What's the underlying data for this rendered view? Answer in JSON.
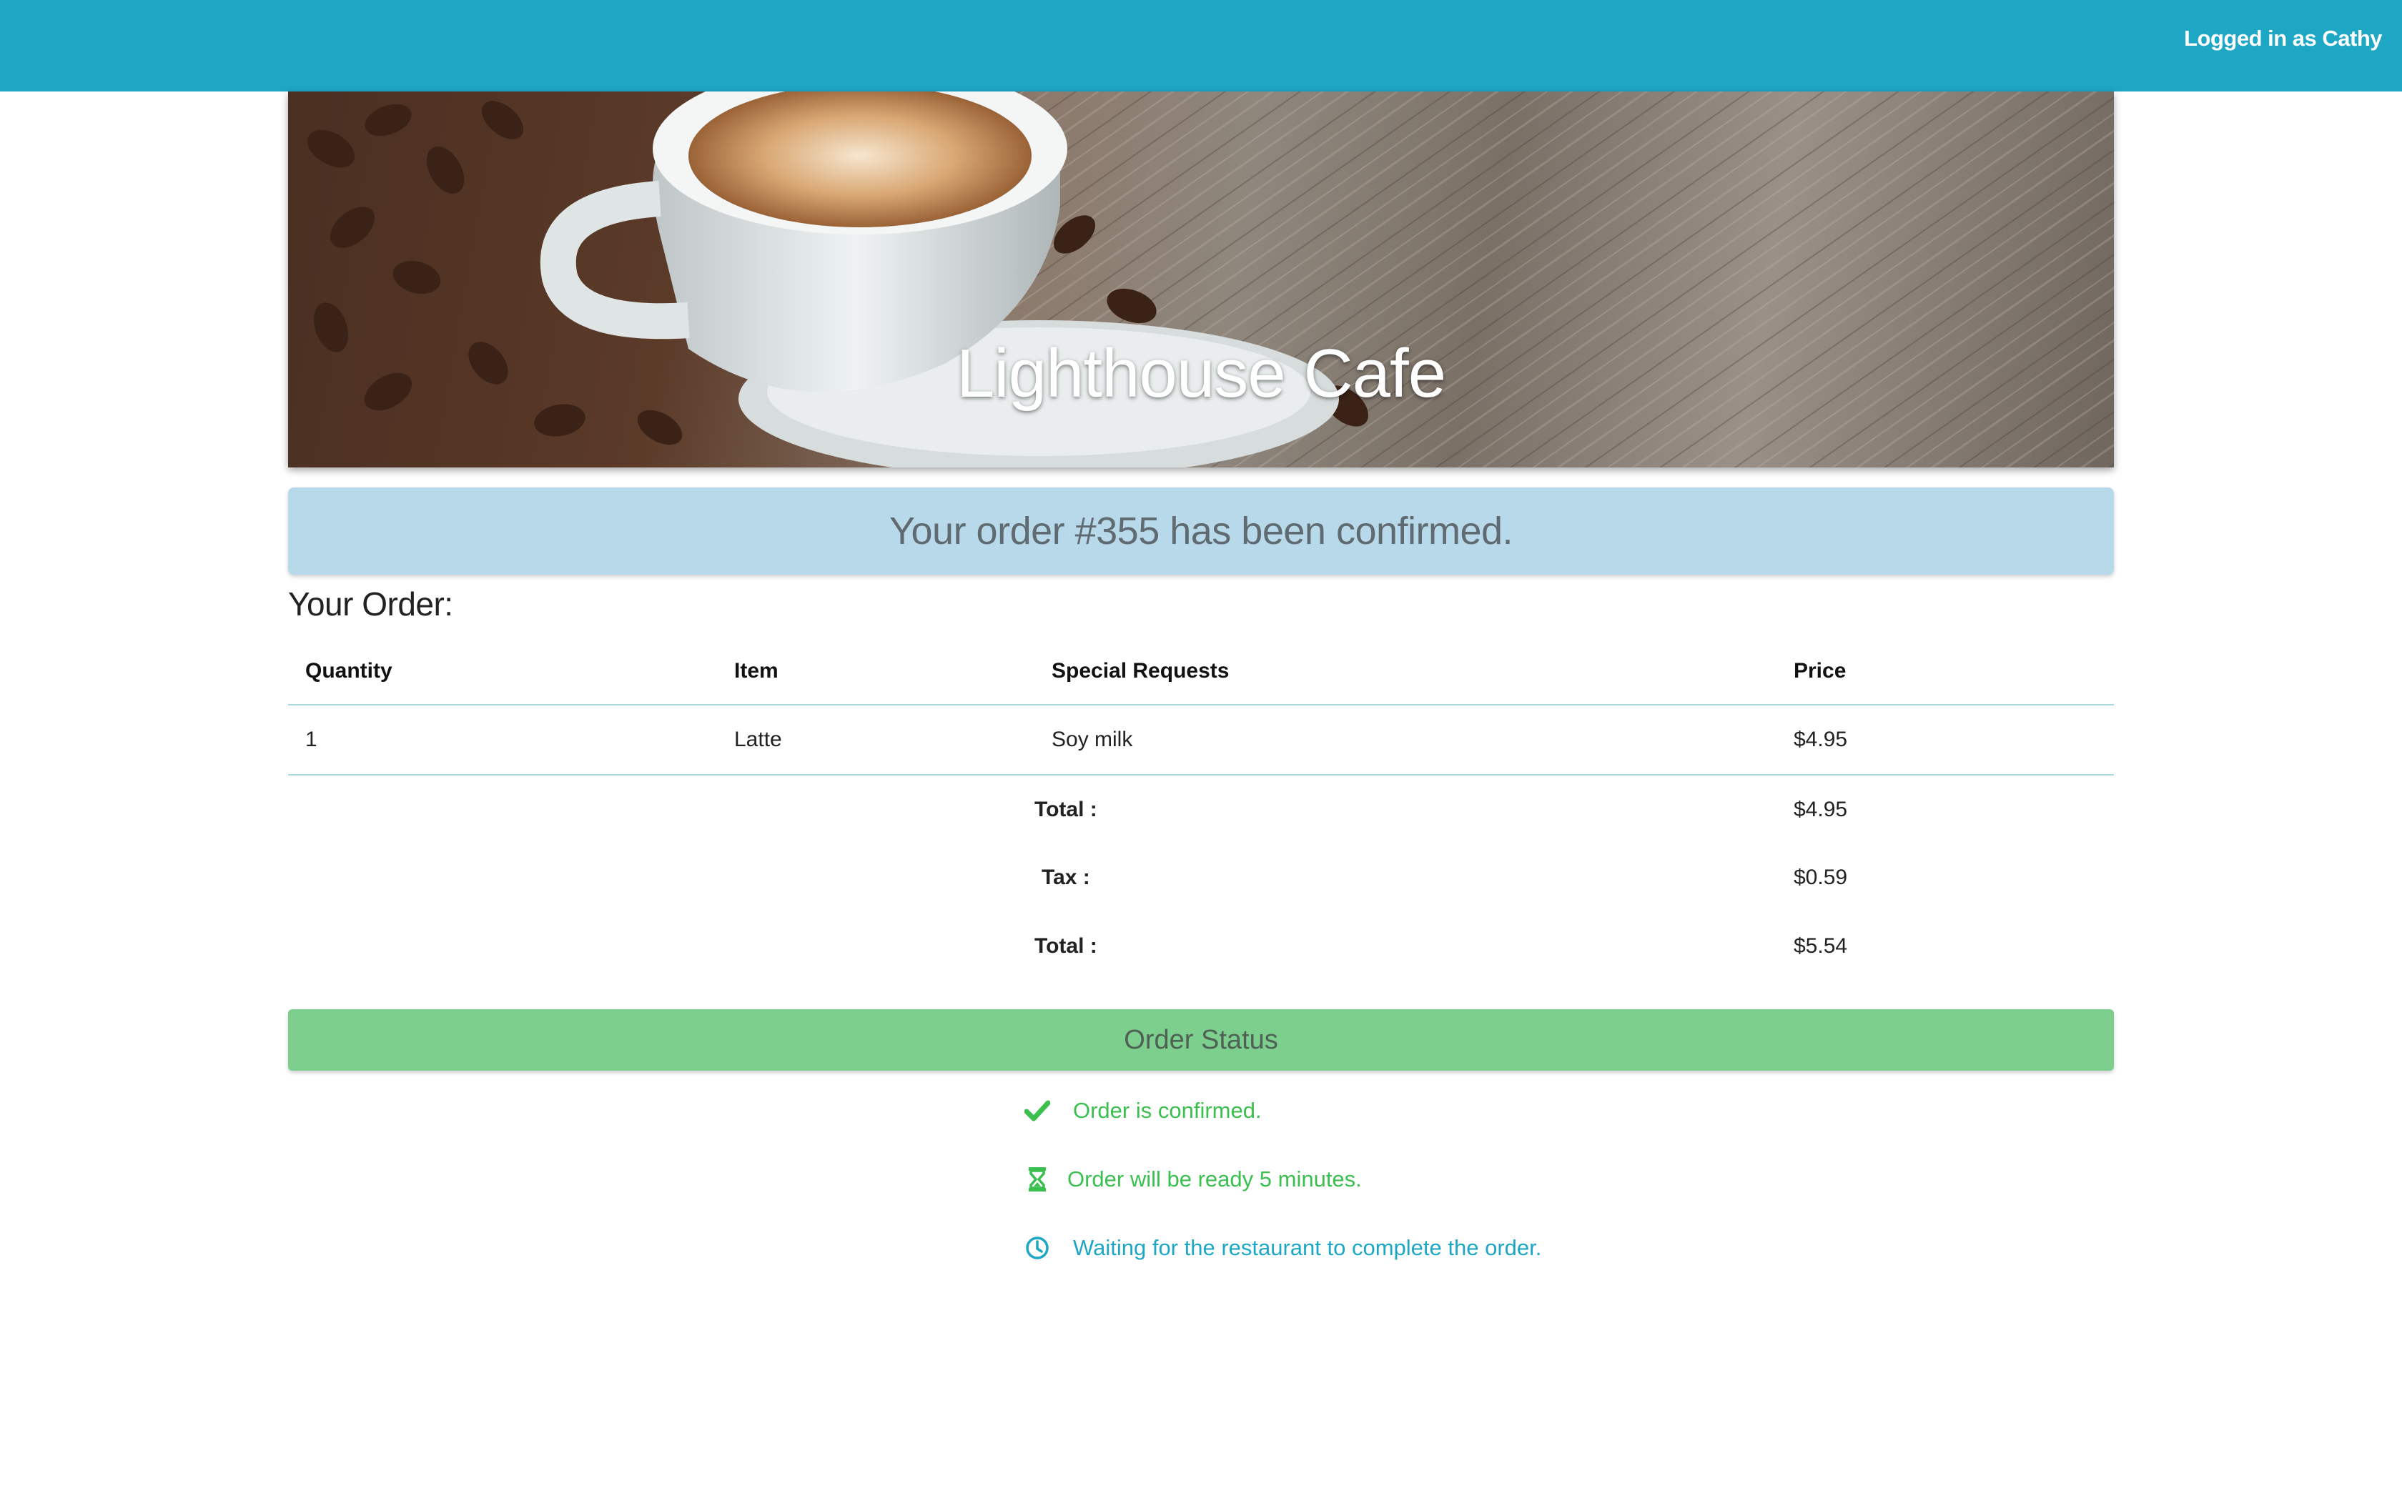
{
  "header": {
    "user_label": "Logged in as Cathy",
    "bg_color": "#1ea7c5"
  },
  "hero": {
    "title": "Lighthouse Cafe"
  },
  "confirmation": {
    "message": "Your order #355 has been confirmed."
  },
  "order": {
    "heading": "Your Order:",
    "columns": [
      "Quantity",
      "Item",
      "Special Requests",
      "Price"
    ],
    "items": [
      {
        "quantity": "1",
        "item": "Latte",
        "special_requests": "Soy milk",
        "price": "$4.95"
      }
    ],
    "totals": [
      {
        "label": "Total :",
        "value": "$4.95"
      },
      {
        "label": "Tax :",
        "value": "$0.59"
      },
      {
        "label": "Total :",
        "value": "$5.54"
      }
    ]
  },
  "status": {
    "heading": "Order Status",
    "steps": [
      {
        "icon": "checkmark-icon",
        "text": "Order is confirmed.",
        "color": "#3bbf4f"
      },
      {
        "icon": "hourglass-icon",
        "text": "Order will be ready 5 minutes.",
        "color": "#3bbf4f"
      },
      {
        "icon": "clock-icon",
        "text": "Waiting for the restaurant to complete the order.",
        "color": "#1ea7c5"
      }
    ]
  }
}
